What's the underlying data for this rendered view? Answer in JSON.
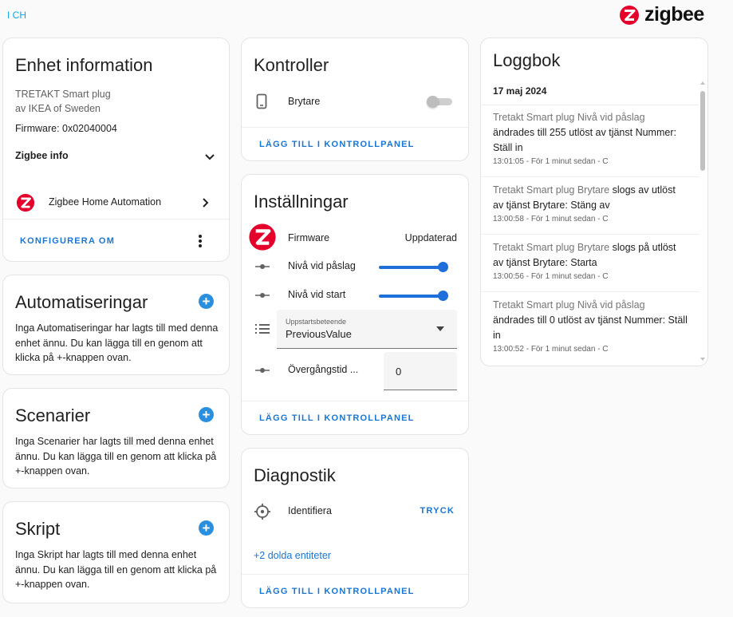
{
  "top_link": "I CH",
  "brand": {
    "name": "zigbee",
    "color": "#e4002b"
  },
  "device_info": {
    "title": "Enhet information",
    "model": "TRETAKT Smart plug",
    "manufacturer": "av IKEA of Sweden",
    "firmware": "Firmware: 0x02040004",
    "zigbee_info_label": "Zigbee info",
    "integration_label": "Zigbee Home Automation",
    "configure_label": "KONFIGURERA OM"
  },
  "automations": {
    "title": "Automatiseringar",
    "text": "Inga Automatiseringar har lagts till med denna enhet ännu. Du kan lägga till en genom att klicka på +-knappen ovan."
  },
  "scenes": {
    "title": "Scenarier",
    "text": "Inga Scenarier har lagts till med denna enhet ännu. Du kan lägga till en genom att klicka på +-knappen ovan."
  },
  "scripts": {
    "title": "Skript",
    "text": "Inga Skript har lagts till med denna enhet ännu. Du kan lägga till en genom att klicka på +-knappen ovan."
  },
  "controls": {
    "title": "Kontroller",
    "switch_label": "Brytare",
    "switch_on": false,
    "add_label": "LÄGG TILL I KONTROLLPANEL"
  },
  "settings": {
    "title": "Inställningar",
    "firmware_label": "Firmware",
    "firmware_status": "Uppdaterad",
    "on_level_label": "Nivå vid påslag",
    "on_level_fraction": 1.0,
    "start_level_label": "Nivå vid start",
    "start_level_fraction": 1.0,
    "startup_field_label": "Uppstartsbeteende",
    "startup_value": "PreviousValue",
    "transition_label": "Övergångstid ...",
    "transition_value": "0",
    "add_label": "LÄGG TILL I KONTROLLPANEL"
  },
  "diagnostics": {
    "title": "Diagnostik",
    "identify_label": "Identifiera",
    "identify_action": "TRYCK",
    "hidden_entities": "+2 dolda entiteter",
    "add_label": "LÄGG TILL I KONTROLLPANEL"
  },
  "logbook": {
    "title": "Loggbok",
    "date": "17 maj 2024",
    "entries": [
      {
        "entity": "Tretakt Smart plug Nivå vid påslag",
        "text": "ändrades till 255 utlöst av tjänst Nummer: Ställ in",
        "meta": "13:01:05 - För 1 minut sedan - C"
      },
      {
        "entity": "Tretakt Smart plug Brytare",
        "text": "slogs av utlöst av tjänst Brytare: Stäng av",
        "meta": "13:00:58 - För 1 minut sedan - C"
      },
      {
        "entity": "Tretakt Smart plug Brytare",
        "text": "slogs på utlöst av tjänst Brytare: Starta",
        "meta": "13:00:56 - För 1 minut sedan - C"
      },
      {
        "entity": "Tretakt Smart plug Nivå vid påslag",
        "text": "ändrades till 0 utlöst av tjänst Nummer: Ställ in",
        "meta": "13:00:52 - För 1 minut sedan - C"
      }
    ]
  }
}
